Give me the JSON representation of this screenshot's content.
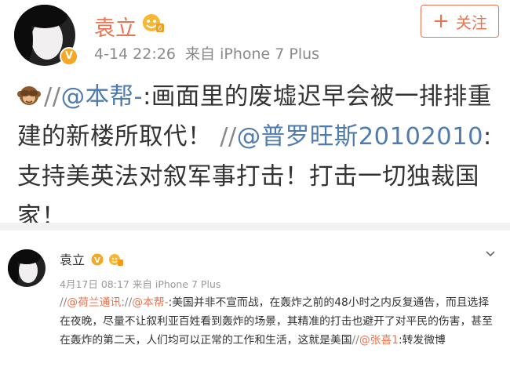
{
  "post1": {
    "username": "袁立",
    "timestamp": "4-14 22:26",
    "source_prefix": "来自",
    "source_device": "iPhone 7 Plus",
    "follow_plus": "+",
    "follow_label": "关注",
    "content": {
      "emoji": "see-no-evil-monkey",
      "slashes1": "//",
      "mention1": "@本帮-",
      "colon1": ":",
      "text1": "画面里的废墟迟早会被一排排重建的新楼所取代！",
      "slashes2": "//",
      "mention2": "@普罗旺斯20102010",
      "colon2": ":",
      "text2": "支持美英法对叙军事打击！打击一切独裁国家！"
    }
  },
  "post2": {
    "username": "袁立",
    "timestamp": "4月17日 08:17",
    "source_prefix": "来自",
    "source_device": "iPhone 7 Plus",
    "content": {
      "slashes1": "//",
      "mention1": "@荷兰通讯",
      "slashes2": "://",
      "mention2": "@本帮-",
      "colon2": ":",
      "text1": "美国并非不宣而战，在轰炸之前的48小时之内反复通告，而且选择在夜晚，尽量不让叙利亚百姓看到轰炸的场景，其精准的打击也避开了对平民的伤害，甚至在轰炸的第二天，人们均可以正常的工作和生活，这就是美国",
      "slashes3": "//",
      "mention3": "@张喜1",
      "colon3": ":",
      "text2": "转发微博"
    }
  },
  "colors": {
    "username": "#eb7350",
    "mention": "#4f7cae",
    "mention_small": "#eb7350",
    "meta": "#8a8a8a",
    "verified_badge": "#f5a623"
  }
}
